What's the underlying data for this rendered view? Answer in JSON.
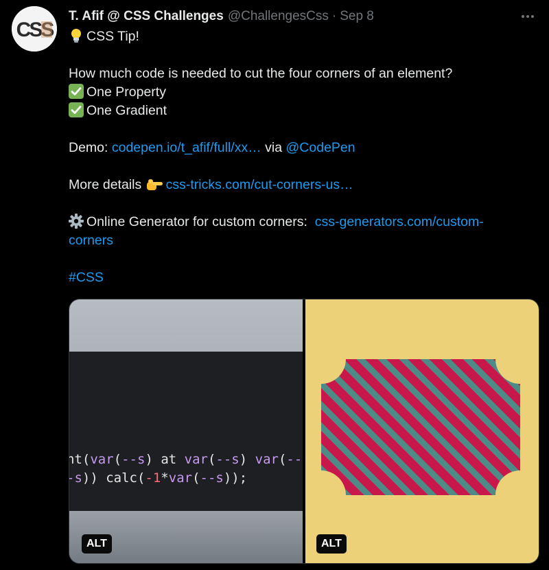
{
  "author": {
    "avatar_text": "CSS",
    "name": "T. Afif @ CSS Challenges",
    "handle": "@ChallengesCss",
    "separator": "·",
    "date": "Sep 8"
  },
  "icons": {
    "more": "more-icon",
    "bulb": "light-bulb-icon",
    "check": "check-mark-icon",
    "point": "pointing-hand-icon",
    "gear": "gear-icon"
  },
  "tweet": {
    "tip_label": "CSS Tip!",
    "question": "How much code is needed to cut the four corners of an element?",
    "check_1": "One Property",
    "check_2": "One Gradient",
    "demo_label": "Demo:",
    "demo_link": "codepen.io/t_afif/full/xx…",
    "via_label": "via",
    "codepen_mention": "@CodePen",
    "more_label": "More details",
    "more_link": "css-tricks.com/cut-corners-us…",
    "generator_label": "Online Generator for custom corners:",
    "generator_link": "css-generators.com/custom-corners",
    "hashtag": "#CSS"
  },
  "media": {
    "code_line_1": {
      "a": "nt(",
      "b": "var",
      "c": "(",
      "d": "--s",
      "e": ") at ",
      "f": "var",
      "g": "(",
      "h": "--s",
      "i": ") ",
      "j": "var",
      "k": "(",
      "l": "--s"
    },
    "code_line_2": {
      "a": "-s",
      "b": ")) calc(",
      "c": "-1",
      "d": "*",
      "e": "var",
      "f": "(",
      "g": "--s",
      "h": "));"
    },
    "alt_left": "ALT",
    "alt_right": "ALT",
    "colors": {
      "right_bg": "#ecd179",
      "stripe_a": "#c8174a",
      "stripe_b": "#4e8b86"
    }
  },
  "colors": {
    "link": "#1d9bf0",
    "muted": "#71767b",
    "text": "#e7e9ea"
  }
}
